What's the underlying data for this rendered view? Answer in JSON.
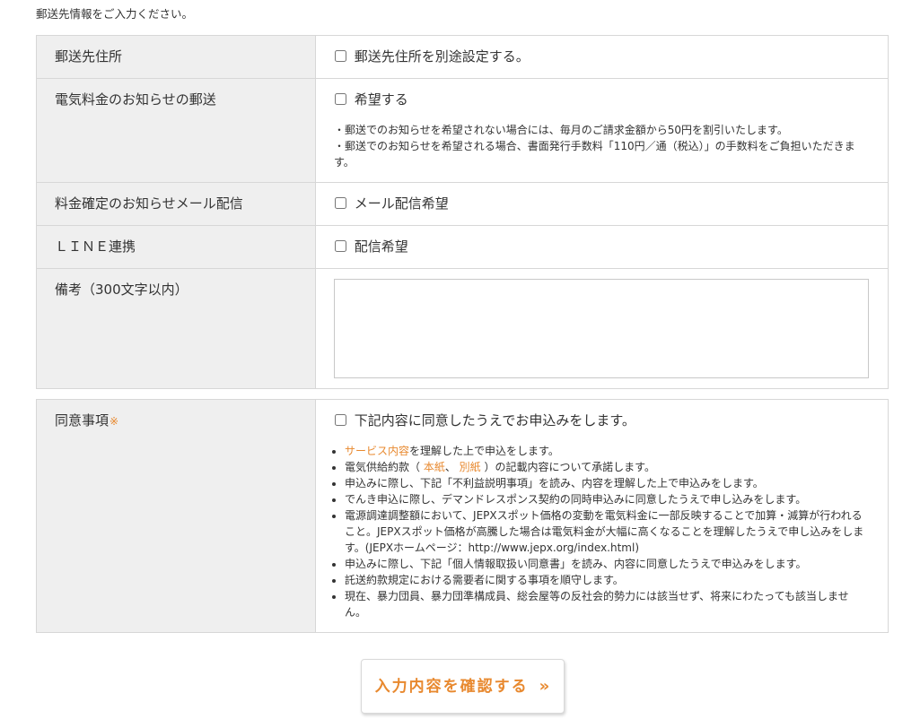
{
  "intro_text": "郵送先情報をご入力ください。",
  "mailing": {
    "address": {
      "label": "郵送先住所",
      "checkbox_label": "郵送先住所を別途設定する。",
      "checked": false
    },
    "bill_notice": {
      "label": "電気料金のお知らせの郵送",
      "checkbox_label": "希望する",
      "checked": false,
      "notes": [
        "・郵送でのお知らせを希望されない場合には、毎月のご請求金額から50円を割引いたします。",
        "・郵送でのお知らせを希望される場合、書面発行手数料「110円／通（税込）」の手数料をご負担いただきます。"
      ]
    },
    "email_notice": {
      "label": "料金確定のお知らせメール配信",
      "checkbox_label": "メール配信希望",
      "checked": false
    },
    "line": {
      "label": "ＬＩＮＥ連携",
      "checkbox_label": "配信希望",
      "checked": false
    },
    "remarks": {
      "label": "備考（300文字以内）",
      "value": ""
    }
  },
  "consent": {
    "label": "同意事項",
    "required_mark": "※",
    "checkbox_label": "下記内容に同意したうえでお申込みをします。",
    "checked": false,
    "items": [
      {
        "parts": [
          "サービス内容",
          "を理解した上で申込をします。"
        ]
      },
      {
        "parts": [
          "電気供給約款（ ",
          "本紙",
          "、 ",
          "別紙",
          " ）の記載内容について承諾します。"
        ]
      },
      {
        "parts": [
          "申込みに際し、下記「不利益説明事項」を読み、内容を理解した上で申込みをします。"
        ]
      },
      {
        "parts": [
          "でんき申込に際し、デマンドレスポンス契約の同時申込みに同意したうえで申し込みをします。"
        ]
      },
      {
        "parts": [
          "電源調達調整額において、JEPXスポット価格の変動を電気料金に一部反映することで加算・減算が行われること。JEPXスポット価格が高騰した場合は電気料金が大幅に高くなることを理解したうえで申し込みをします。(JEPXホームページ：http://www.jepx.org/index.html)"
        ]
      },
      {
        "parts": [
          "申込みに際し、下記「個人情報取扱い同意書」を読み、内容に同意したうえで申込みをします。"
        ]
      },
      {
        "parts": [
          "託送約款規定における需要者に関する事項を順守します。"
        ]
      },
      {
        "parts": [
          "現在、暴力団員、暴力団準構成員、総会屋等の反社会的勢力には該当せず、将来にわたっても該当しません。"
        ]
      }
    ]
  },
  "submit": {
    "label": "入力内容を確認する",
    "icon": "double-chevron-right-icon",
    "icon_glyph": "»"
  },
  "colors": {
    "accent": "#e8892f",
    "label_background": "#efefef",
    "border": "#d7d7d7",
    "text": "#333333"
  }
}
